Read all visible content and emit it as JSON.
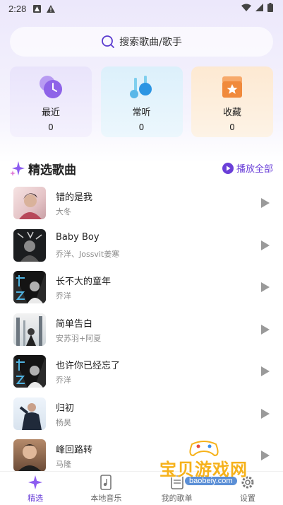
{
  "status_bar": {
    "time": "2:28"
  },
  "search": {
    "placeholder": "搜索歌曲/歌手"
  },
  "quick_cards": [
    {
      "label": "最近",
      "count": "0"
    },
    {
      "label": "常听",
      "count": "0"
    },
    {
      "label": "收藏",
      "count": "0"
    }
  ],
  "section": {
    "title": "精选歌曲",
    "play_all_label": "播放全部"
  },
  "songs": [
    {
      "title": "错的是我",
      "artist": "大冬"
    },
    {
      "title": "Baby Boy",
      "artist": "乔洋、Jossvit姜寒"
    },
    {
      "title": "长不大的童年",
      "artist": "乔洋"
    },
    {
      "title": "简单告白",
      "artist": "安苏羽+阿夏"
    },
    {
      "title": "也许你已经忘了",
      "artist": "乔洋"
    },
    {
      "title": "归初",
      "artist": "杨昊"
    },
    {
      "title": "峰回路转",
      "artist": "马隆"
    }
  ],
  "tabs": [
    {
      "label": "精选",
      "active": true
    },
    {
      "label": "本地音乐",
      "active": false
    },
    {
      "label": "我的歌单",
      "active": false
    },
    {
      "label": "设置",
      "active": false
    }
  ],
  "watermark": {
    "text": "宝贝游戏网",
    "url": "baobeiy.com"
  },
  "colors": {
    "accent": "#6a3fd8",
    "play_icon": "#9a9a9a"
  }
}
